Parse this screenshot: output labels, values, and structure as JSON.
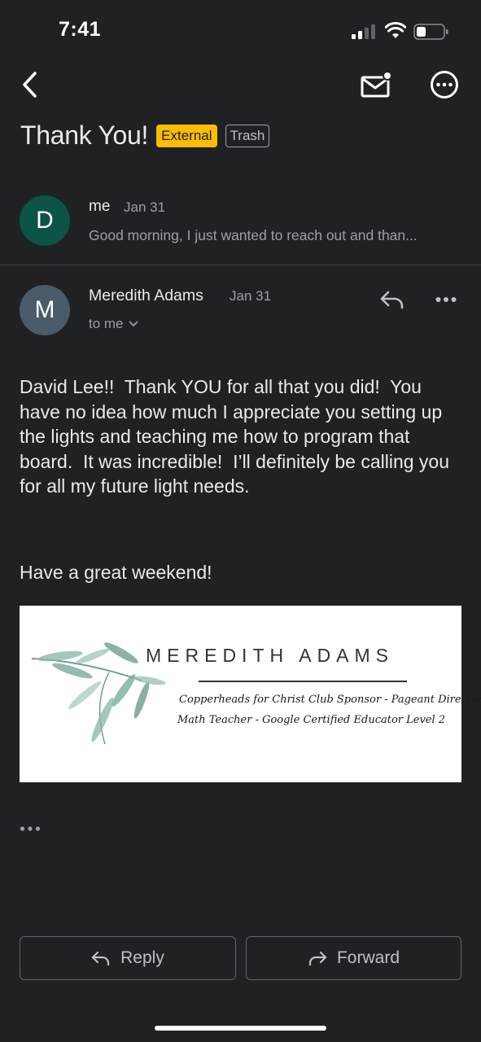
{
  "status_bar": {
    "time": "7:41"
  },
  "subject": {
    "title": "Thank You!",
    "labels": [
      "External",
      "Trash"
    ],
    "colors": {
      "external_bg": "#fbbc04"
    }
  },
  "collapsed_message": {
    "avatar_letter": "D",
    "avatar_color": "#0b5446",
    "sender": "me",
    "date": "Jan 31",
    "snippet": "Good morning, I just wanted to reach out and than..."
  },
  "expanded_message": {
    "avatar_letter": "M",
    "avatar_color": "#4a5a68",
    "sender": "Meredith Adams",
    "date": "Jan 31",
    "recipient": "to me",
    "body": "David Lee!!  Thank YOU for all that you did!  You have no idea how much I appreciate you setting up the lights and teaching me how to program that board.  It was incredible!  I’ll definitely be calling you for all my future light needs.",
    "closing": "Have a great weekend!",
    "signature": {
      "name": "MEREDITH ADAMS",
      "line1": "Copperheads for Christ Club Sponsor - Pageant Director",
      "line2": "Math Teacher - Google Certified Educator Level 2"
    }
  },
  "actions": {
    "reply": "Reply",
    "forward": "Forward"
  },
  "icons": [
    "back-arrow-icon",
    "mark-unread-icon",
    "more-options-icon",
    "reply-icon",
    "more-horiz-icon",
    "forward-icon",
    "chevron-down-icon"
  ]
}
